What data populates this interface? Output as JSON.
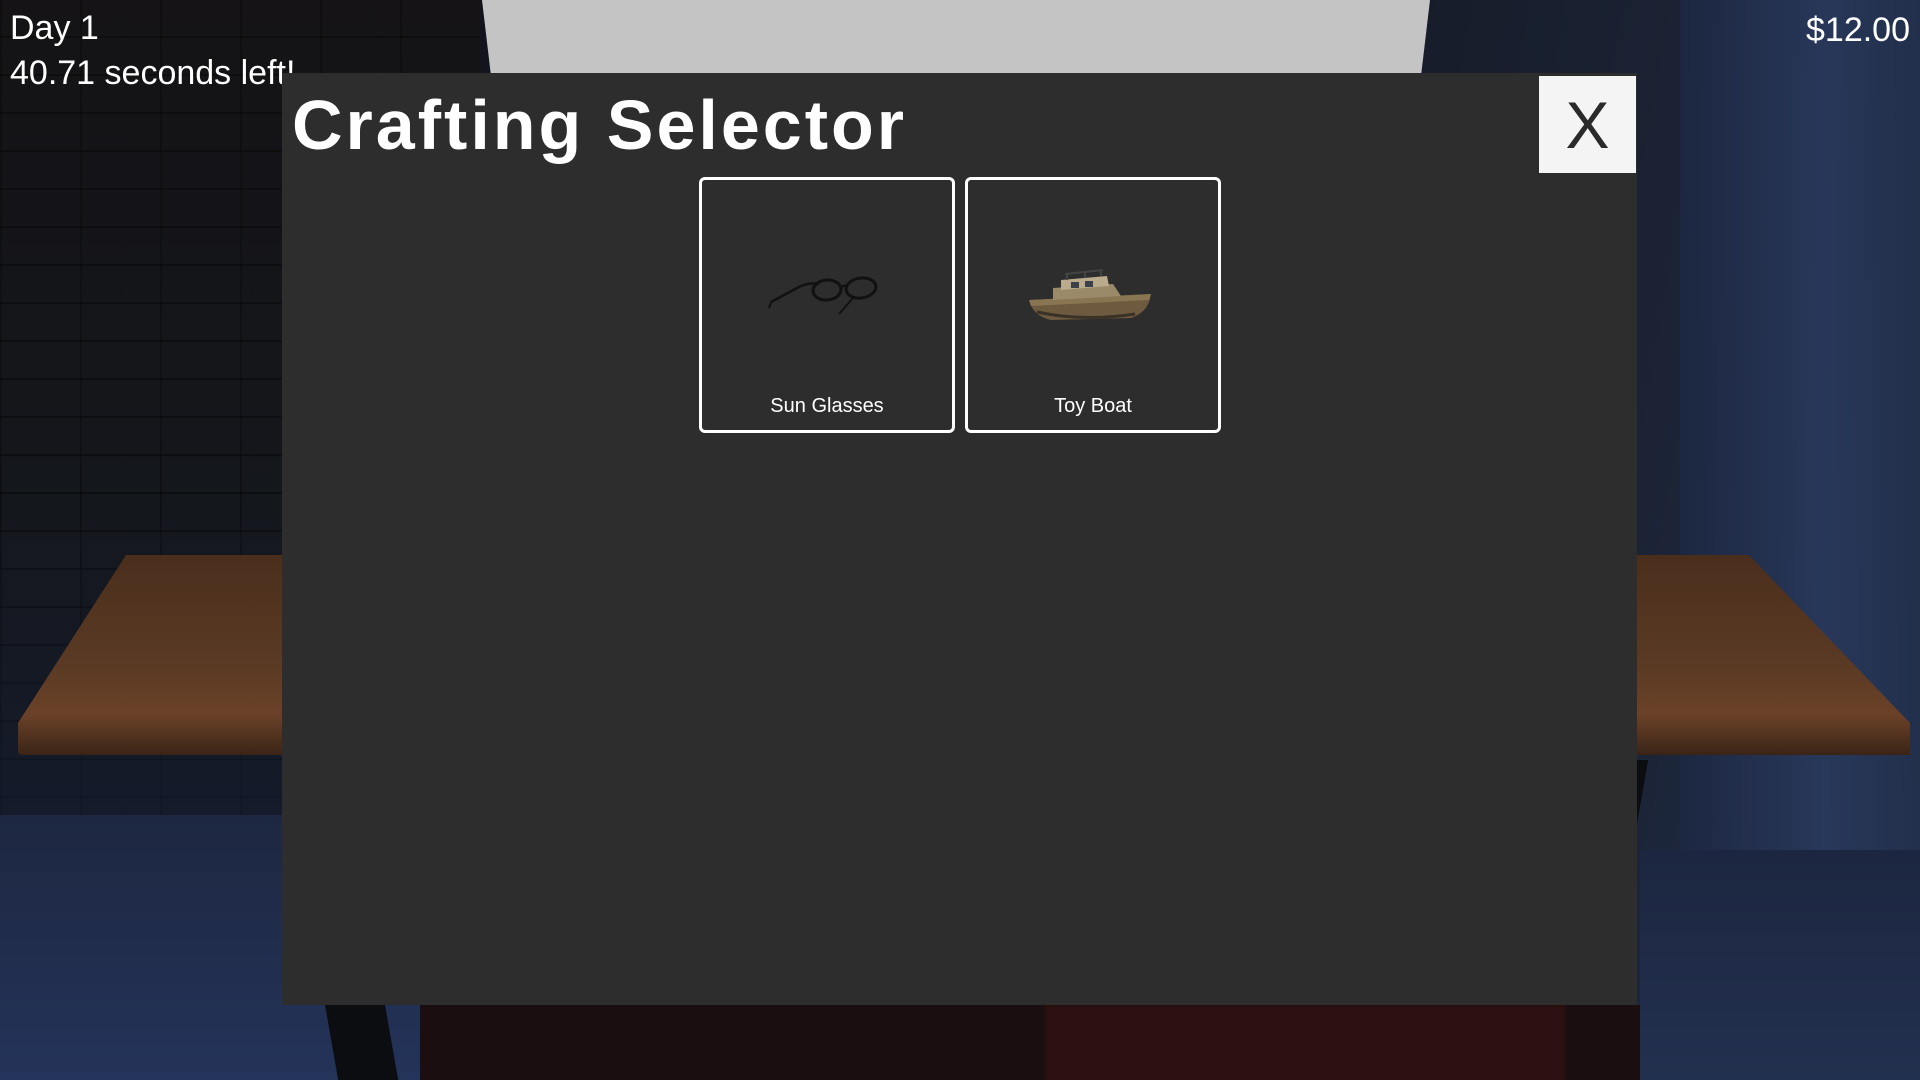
{
  "hud": {
    "day": "Day 1",
    "timer": "40.71 seconds left!",
    "money": "$12.00"
  },
  "crafting_selector": {
    "title": "Crafting Selector",
    "close_label": "X",
    "recipes": [
      {
        "label": "Sun Glasses",
        "icon": "sunglasses-icon"
      },
      {
        "label": "Toy Boat",
        "icon": "toy-boat-icon"
      }
    ]
  },
  "colors": {
    "panel_background": "#2d2d2d",
    "close_button_background": "#f4f4f4",
    "card_border": "#ffffff",
    "text": "#ffffff"
  }
}
